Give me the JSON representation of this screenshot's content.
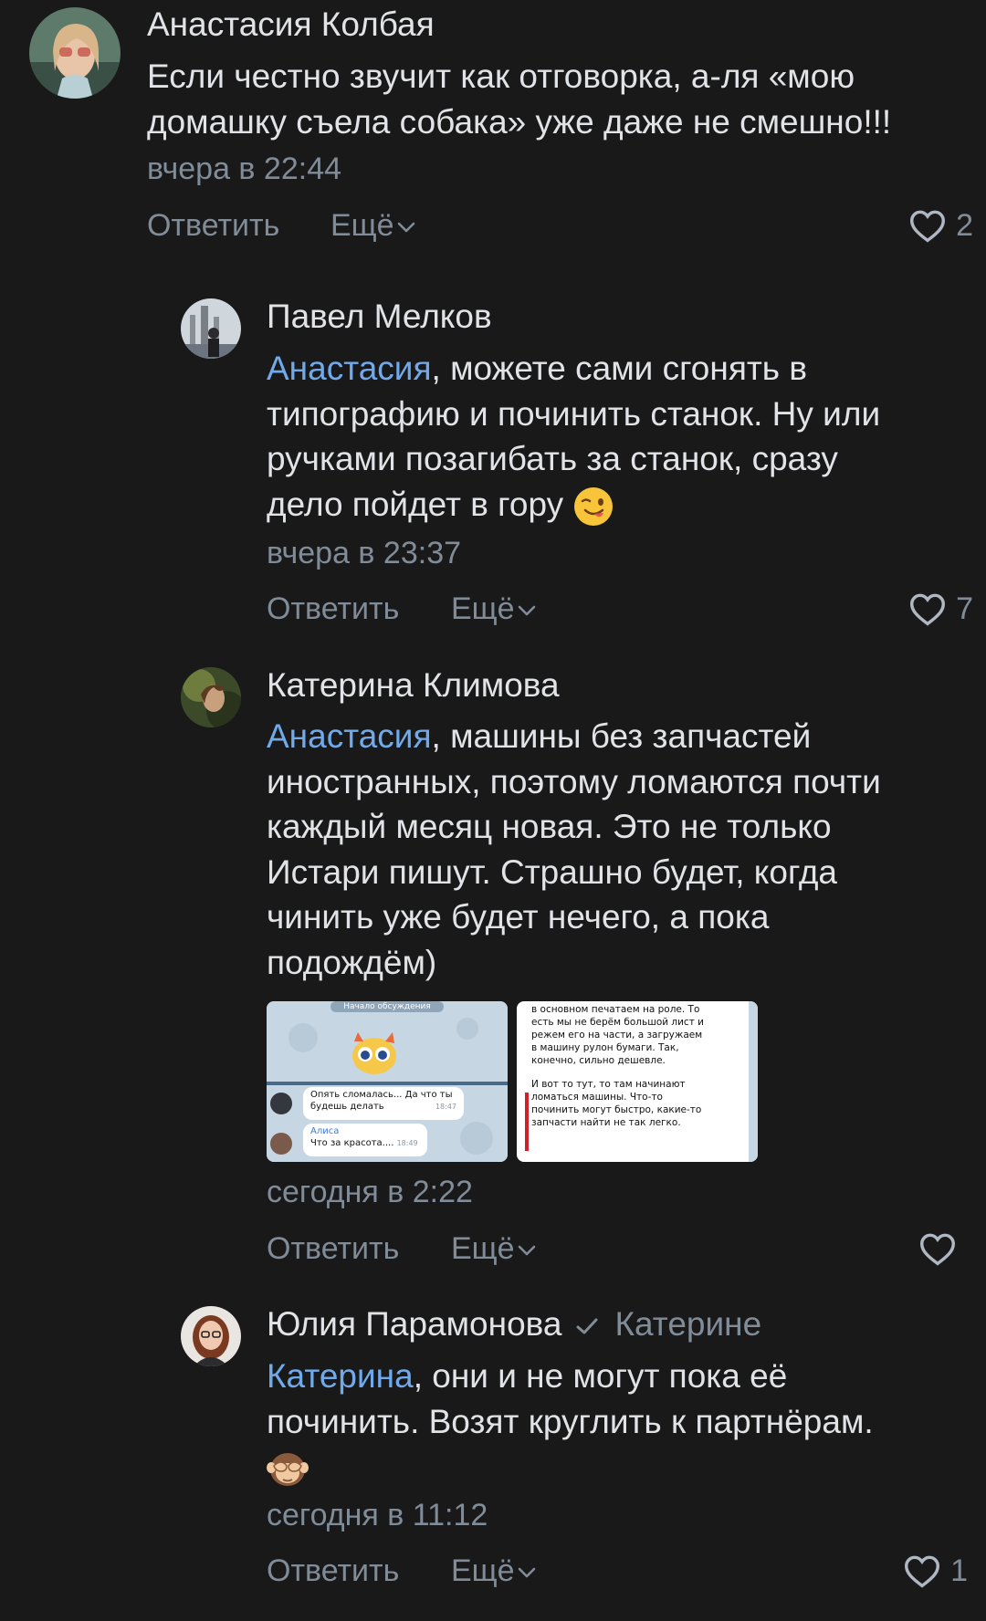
{
  "comments": [
    {
      "author": "Анастасия Колбая",
      "text_line1": "Если честно звучит как отговорка, а-ля «мою",
      "text_line2": "домашку съела собака» уже даже не смешно!!!",
      "time": "вчера в 22:44",
      "reply_label": "Ответить",
      "more_label": "Ещё",
      "likes": "2"
    },
    {
      "author": "Павел Мелков",
      "mention": "Анастасия",
      "text_line1_rest": ", можете сами сгонять в",
      "text_line2": "типографию и починить станок. Ну или",
      "text_line3": "ручками позагибать за станок, сразу",
      "text_line4": "дело пойдет в гору",
      "emoji": "wink-tongue-emoji",
      "time": "вчера в 23:37",
      "reply_label": "Ответить",
      "more_label": "Ещё",
      "likes": "7"
    },
    {
      "author": "Катерина Климова",
      "mention": "Анастасия",
      "text_line1_rest": ", машины без запчастей",
      "text_line2": "иностранных, поэтому ломаются почти",
      "text_line3": "каждый месяц новая. Это не только",
      "text_line4": "Истари пишут. Страшно будет, когда",
      "text_line5": "чинить уже будет нечего, а пока",
      "text_line6": "подождём)",
      "attachment1": {
        "header": "Начало обсуждения",
        "msg1": "Опять сломалась... Да что ты",
        "msg1b": "будешь делать",
        "msg1_time": "18:47",
        "msg2_name": "Алиса",
        "msg2": "Что за красота....",
        "msg2_time": "18:49"
      },
      "attachment2": {
        "p1_l1": "в основном печатаем на роле. То",
        "p1_l2": "есть мы не берём большой лист и",
        "p1_l3": "режем его на части, а загружаем",
        "p1_l4": "в машину рулон бумаги. Так,",
        "p1_l5": "конечно, сильно дешевле.",
        "p2_l1": "И вот то тут, то там начинают",
        "p2_l2": "ломаться машины. Что-то",
        "p2_l3": "починить могут быстро, какие-то",
        "p2_l4": "запчасти найти не так легко."
      },
      "time": "сегодня в 2:22",
      "reply_label": "Ответить",
      "more_label": "Ещё",
      "likes": ""
    },
    {
      "author": "Юлия Парамонова",
      "reply_to": "Катерине",
      "mention": "Катерина",
      "text_line1_rest": ", они и не могут пока её",
      "text_line2": "починить. Возят круглить к партнёрам.",
      "emoji": "see-no-evil-monkey-emoji",
      "time": "сегодня в 11:12",
      "reply_label": "Ответить",
      "more_label": "Ещё",
      "likes": "1"
    }
  ],
  "colors": {
    "background": "#19191a",
    "text": "#e1e3e6",
    "secondary": "#818c99",
    "mention": "#71aaeb"
  }
}
